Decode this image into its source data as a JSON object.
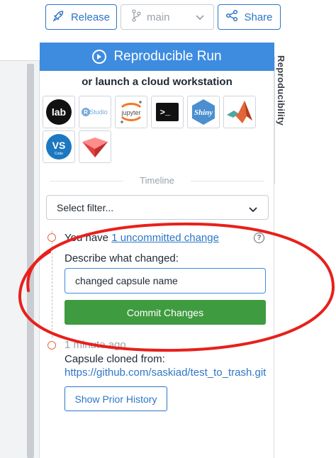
{
  "toolbar": {
    "release_label": "Release",
    "branch_value": "main",
    "share_label": "Share"
  },
  "side_tab": {
    "label": "Reproducibility"
  },
  "panel": {
    "repro_label": "Reproducible Run",
    "cloud_title": "or launch a cloud workstation",
    "tools": [
      {
        "name": "jupyterlab",
        "text": "lab"
      },
      {
        "name": "rstudio",
        "text": "Studio"
      },
      {
        "name": "jupyter",
        "text": "jupyter"
      },
      {
        "name": "terminal",
        "text": ">_"
      },
      {
        "name": "shiny",
        "text": "Shiny"
      },
      {
        "name": "matlab",
        "text": ""
      },
      {
        "name": "vscode",
        "text": "VS"
      },
      {
        "name": "streamlit",
        "text": ""
      }
    ],
    "vscode_sub": "Code",
    "timeline_label": "Timeline",
    "filter_placeholder": "Select filter...",
    "uncommitted_prefix": "You have ",
    "uncommitted_link": "1 uncommitted change",
    "help_glyph": "?",
    "describe_label": "Describe what changed:",
    "describe_value": "changed capsule name",
    "commit_label": "Commit Changes",
    "cloned_time": "1 minute ago",
    "cloned_label": "Capsule cloned from:",
    "cloned_url": "https://github.com/saskiad/test_to_trash.git",
    "prior_history_label": "Show Prior History"
  },
  "colors": {
    "accent": "#3d8ce0",
    "link": "#2d76c7",
    "commit": "#3f9b40",
    "timeline_dot": "#e66a3c",
    "annotation": "#e8201b"
  }
}
